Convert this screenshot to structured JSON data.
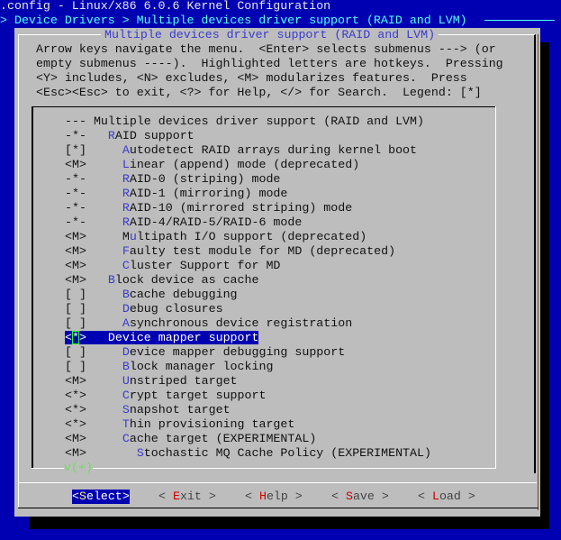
{
  "window": {
    "title": ".config - Linux/x86 6.0.6 Kernel Configuration",
    "breadcrumb": "> Device Drivers > Multiple devices driver support (RAID and LVM)"
  },
  "dialog": {
    "title": "Multiple devices driver support (RAID and LVM)",
    "help_lines": [
      "Arrow keys navigate the menu.  <Enter> selects submenus ---> (or",
      "empty submenus ----).  Highlighted letters are hotkeys.  Pressing",
      "<Y> includes, <N> excludes, <M> modularizes features.  Press",
      "<Esc><Esc> to exit, <?> for Help, </> for Search.  Legend: [*]"
    ],
    "more_indicator": "v(+)"
  },
  "menu": {
    "items": [
      {
        "state": "---",
        "indent": " ",
        "hotkey": "",
        "rest": "Multiple devices driver support (RAID and LVM)",
        "selected": false
      },
      {
        "state": "-*-",
        "indent": "   ",
        "hotkey": "R",
        "rest": "AID support",
        "selected": false
      },
      {
        "state": "[*]",
        "indent": "     ",
        "hotkey": "A",
        "rest": "utodetect RAID arrays during kernel boot",
        "selected": false
      },
      {
        "state": "<M>",
        "indent": "     ",
        "hotkey": "L",
        "rest": "inear (append) mode (deprecated)",
        "selected": false
      },
      {
        "state": "-*-",
        "indent": "     ",
        "hotkey": "R",
        "rest": "AID-0 (striping) mode",
        "selected": false
      },
      {
        "state": "-*-",
        "indent": "     ",
        "hotkey": "R",
        "rest": "AID-1 (mirroring) mode",
        "selected": false
      },
      {
        "state": "-*-",
        "indent": "     ",
        "hotkey": "R",
        "rest": "AID-10 (mirrored striping) mode",
        "selected": false
      },
      {
        "state": "-*-",
        "indent": "     ",
        "hotkey": "R",
        "rest": "AID-4/RAID-5/RAID-6 mode",
        "selected": false
      },
      {
        "state": "<M>",
        "indent": "     ",
        "prefix": "M",
        "hotkey": "u",
        "rest": "ltipath I/O support (deprecated)",
        "selected": false
      },
      {
        "state": "<M>",
        "indent": "     ",
        "hotkey": "F",
        "rest": "aulty test module for MD (deprecated)",
        "selected": false
      },
      {
        "state": "<M>",
        "indent": "     ",
        "hotkey": "C",
        "rest": "luster Support for MD",
        "selected": false
      },
      {
        "state": "<M>",
        "indent": "   ",
        "hotkey": "B",
        "rest": "lock device as cache",
        "selected": false
      },
      {
        "state": "[ ]",
        "indent": "     ",
        "hotkey": "B",
        "rest": "cache debugging",
        "selected": false
      },
      {
        "state": "[ ]",
        "indent": "     ",
        "hotkey": "D",
        "rest": "ebug closures",
        "selected": false
      },
      {
        "state": "[ ]",
        "indent": "     ",
        "hotkey": "A",
        "rest": "synchronous device registration",
        "selected": false
      },
      {
        "state": "<*>",
        "indent": "   ",
        "hotkey": "D",
        "rest": "evice mapper support",
        "selected": true
      },
      {
        "state": "[ ]",
        "indent": "     ",
        "hotkey": "D",
        "rest": "evice mapper debugging support",
        "selected": false
      },
      {
        "state": "[ ]",
        "indent": "     ",
        "hotkey": "B",
        "rest": "lock manager locking",
        "selected": false
      },
      {
        "state": "<M>",
        "indent": "     ",
        "hotkey": "U",
        "rest": "nstriped target",
        "selected": false
      },
      {
        "state": "<*>",
        "indent": "     ",
        "hotkey": "C",
        "rest": "rypt target support",
        "selected": false
      },
      {
        "state": "<*>",
        "indent": "     ",
        "hotkey": "S",
        "rest": "napshot target",
        "selected": false
      },
      {
        "state": "<*>",
        "indent": "     ",
        "hotkey": "T",
        "rest": "hin provisioning target",
        "selected": false
      },
      {
        "state": "<M>",
        "indent": "     ",
        "hotkey": "C",
        "rest": "ache target (EXPERIMENTAL)",
        "selected": false
      },
      {
        "state": "<M>",
        "indent": "       ",
        "hotkey": "S",
        "rest": "tochastic MQ Cache Policy (EXPERIMENTAL)",
        "selected": false
      }
    ]
  },
  "buttons": [
    {
      "id": "select",
      "pre": "<",
      "hotkey": "S",
      "post": "elect>",
      "selected": true
    },
    {
      "id": "exit",
      "pre": "< ",
      "hotkey": "E",
      "post": "xit >",
      "selected": false
    },
    {
      "id": "help",
      "pre": "< ",
      "hotkey": "H",
      "post": "elp >",
      "selected": false
    },
    {
      "id": "save",
      "pre": "< ",
      "hotkey": "S",
      "post": "ave >",
      "selected": false
    },
    {
      "id": "load",
      "pre": "< ",
      "hotkey": "L",
      "post": "oad >",
      "selected": false
    }
  ],
  "colors": {
    "background": "#0000b2",
    "dialog": "#bdbdbd",
    "hotkey": "#3a3acf",
    "button_hotkey": "#cc0000",
    "selection": "#0000b2",
    "more_indicator": "#6fdc5c"
  }
}
